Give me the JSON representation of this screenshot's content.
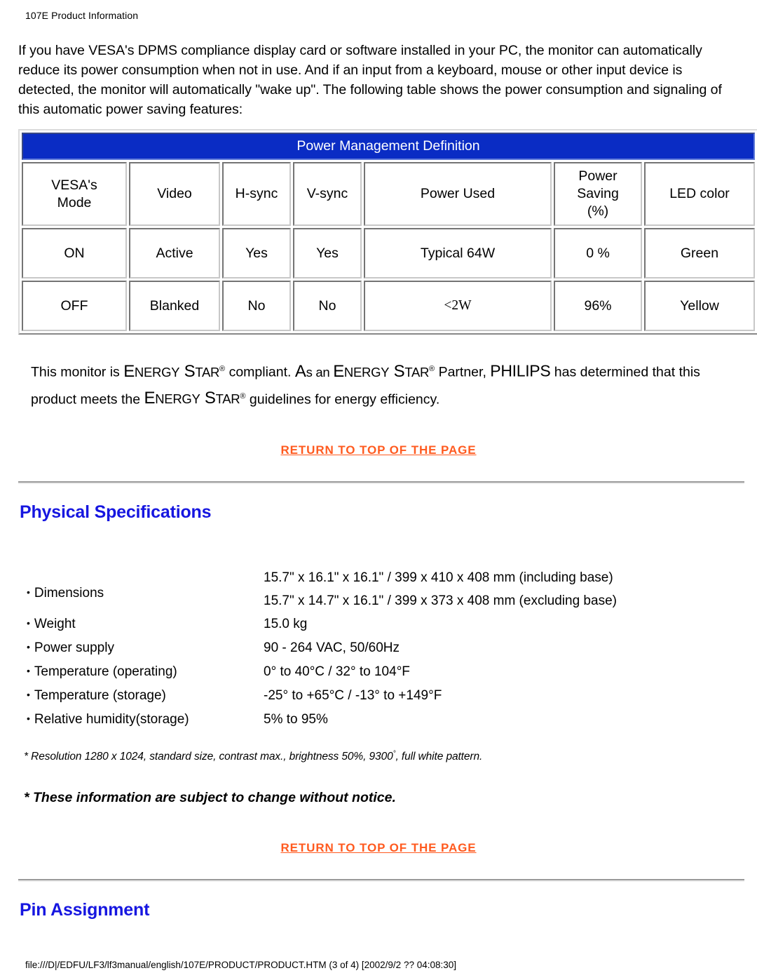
{
  "header": {
    "title": "107E Product Information"
  },
  "intro": {
    "paragraph": "If you have VESA's DPMS compliance display card or software installed in your PC, the monitor can automatically reduce its power consumption when not in use. And if an input from a keyboard, mouse or other input device is detected, the monitor will automatically \"wake up\". The following table shows the power consumption and signaling of this automatic power saving features:"
  },
  "power_table": {
    "title": "Power Management Definition",
    "title_bg": "#0a2cc4",
    "columns": [
      "VESA's Mode",
      "Video",
      "H-sync",
      "V-sync",
      "Power Used",
      "Power Saving (%)",
      "LED color"
    ],
    "columns_display": {
      "c0_line1": "VESA's",
      "c0_line2": "Mode",
      "c1": "Video",
      "c2": "H-sync",
      "c3": "V-sync",
      "c4": "Power Used",
      "c5_line1": "Power",
      "c5_line2": "Saving",
      "c5_line3": "(%)",
      "c6": "LED color"
    },
    "rows": [
      {
        "mode": "ON",
        "video": "Active",
        "hsync": "Yes",
        "vsync": "Yes",
        "power_used": "Typical 64W",
        "power_saving": "0 %",
        "led_color": "Green"
      },
      {
        "mode": "OFF",
        "video": "Blanked",
        "hsync": "No",
        "vsync": "No",
        "power_used": "<2W",
        "power_saving": "96%",
        "led_color": "Yellow"
      }
    ]
  },
  "energy_star": {
    "t1": "This monitor is ",
    "e1_big": "E",
    "e1_small": "NERGY",
    "s1_big": "S",
    "s1_small": "TAR",
    "t2": " compliant. ",
    "a_big": "A",
    "a_small": "s an ",
    "e2_big": "E",
    "e2_small": "NERGY",
    "s2_big": "S",
    "s2_small": "TAR",
    "t3": " Partner, ",
    "philips": "PHILIPS",
    "t4": " has determined that this product meets the ",
    "e3_big": "E",
    "e3_small": "NERGY",
    "s3_big": "S",
    "s3_small": "TAR",
    "t5": " guidelines for energy efficiency.",
    "reg": "®"
  },
  "links": {
    "return_top": "RETURN TO TOP OF THE PAGE",
    "link_color": "#ff5a1f"
  },
  "sections": {
    "physical_specifications": "Physical Specifications",
    "pin_assignment": "Pin Assignment",
    "heading_color": "#1616e0"
  },
  "specs": {
    "bullet": "•",
    "items": [
      {
        "label": "Dimensions",
        "values": [
          "15.7\" x 16.1\" x 16.1\" / 399 x 410 x 408 mm (including base)",
          "15.7\" x 14.7\" x 16.1\" / 399 x 373 x 408 mm (excluding base)"
        ]
      },
      {
        "label": "Weight",
        "values": [
          "15.0 kg"
        ]
      },
      {
        "label": "Power supply",
        "values": [
          "90 - 264 VAC, 50/60Hz"
        ]
      },
      {
        "label": "Temperature (operating)",
        "values": [
          "0° to 40°C / 32° to 104°F"
        ]
      },
      {
        "label": "Temperature (storage)",
        "values": [
          "-25° to +65°C / -13° to +149°F"
        ]
      },
      {
        "label": "Relative humidity(storage)",
        "values": [
          "5% to 95%"
        ]
      }
    ]
  },
  "footnotes": {
    "resolution_note_a": "* Resolution 1280 x 1024, standard size, contrast max., brightness 50%, 9300",
    "resolution_note_sup": "°",
    "resolution_note_b": ", full white pattern.",
    "notice": "* These information are subject to change without notice."
  },
  "footer": {
    "path": "file:///D|/EDFU/LF3/lf3manual/english/107E/PRODUCT/PRODUCT.HTM (3 of 4) [2002/9/2 ?? 04:08:30]"
  }
}
